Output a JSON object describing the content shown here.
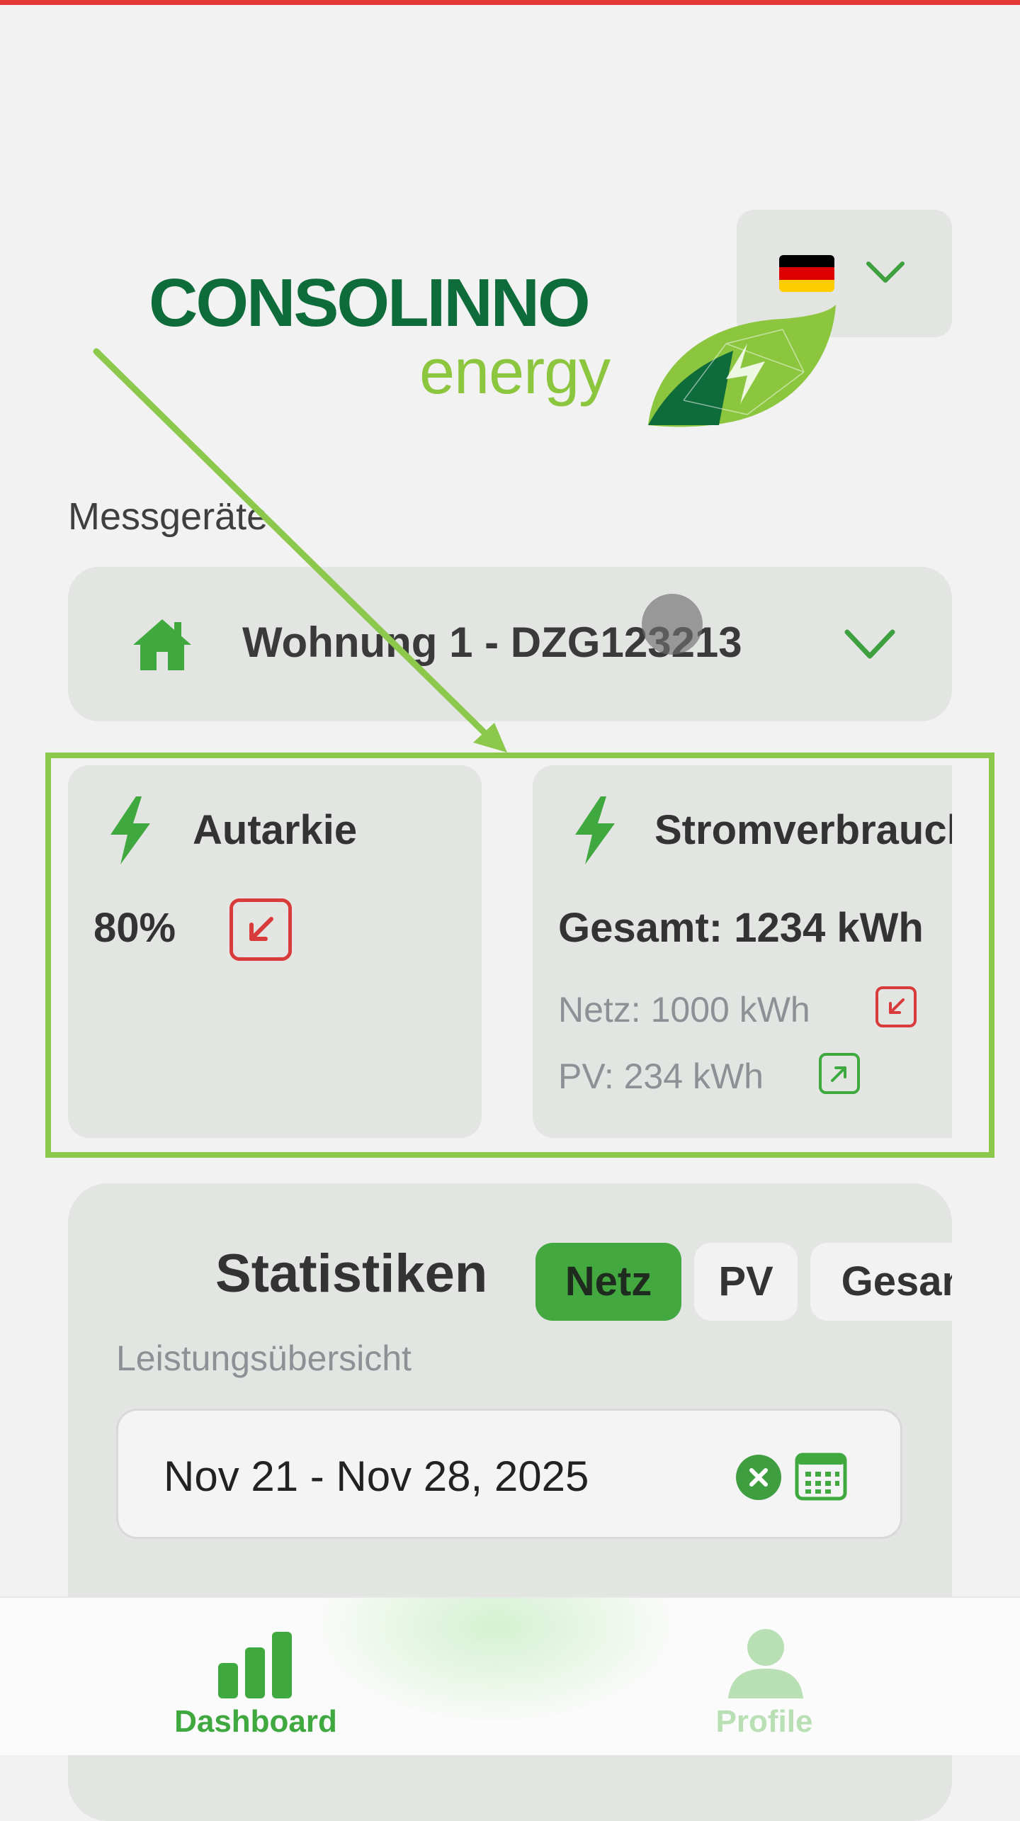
{
  "logo": {
    "line1": "CONSOLINNO",
    "line2": "energy"
  },
  "language": {
    "selected": "de",
    "icon": "germany-flag-icon"
  },
  "devices": {
    "section_label": "Messgeräte",
    "selected": "Wohnung 1 - DZG123213",
    "icon": "home-icon"
  },
  "cards": {
    "autarkie": {
      "title": "Autarkie",
      "value": "80%",
      "trend_icon": "arrow-down-left-icon"
    },
    "stromverbrauch": {
      "title": "Stromverbrauch",
      "total": "Gesamt: 1234 kWh",
      "netz": "Netz: 1000 kWh",
      "pv": "PV: 234 kWh",
      "netz_icon": "arrow-down-left-icon",
      "pv_icon": "arrow-up-right-icon"
    }
  },
  "stats": {
    "title": "Statistiken",
    "tabs": [
      {
        "label": "Netz",
        "active": true
      },
      {
        "label": "PV",
        "active": false
      },
      {
        "label": "Gesamt",
        "active": false
      }
    ],
    "subtitle": "Leistungsübersicht",
    "date_range": "Nov 21 - Nov 28, 2025"
  },
  "nav": {
    "items": [
      {
        "label": "Dashboard",
        "icon": "bar-chart-icon",
        "active": true
      },
      {
        "label": "Profile",
        "icon": "person-icon",
        "active": false
      }
    ]
  },
  "colors": {
    "brand_dark_green": "#0e6b3a",
    "brand_light_green": "#8cc63f",
    "accent_green": "#44a840",
    "alert_red": "#d93a3a",
    "highlight": "#8cc84b"
  }
}
